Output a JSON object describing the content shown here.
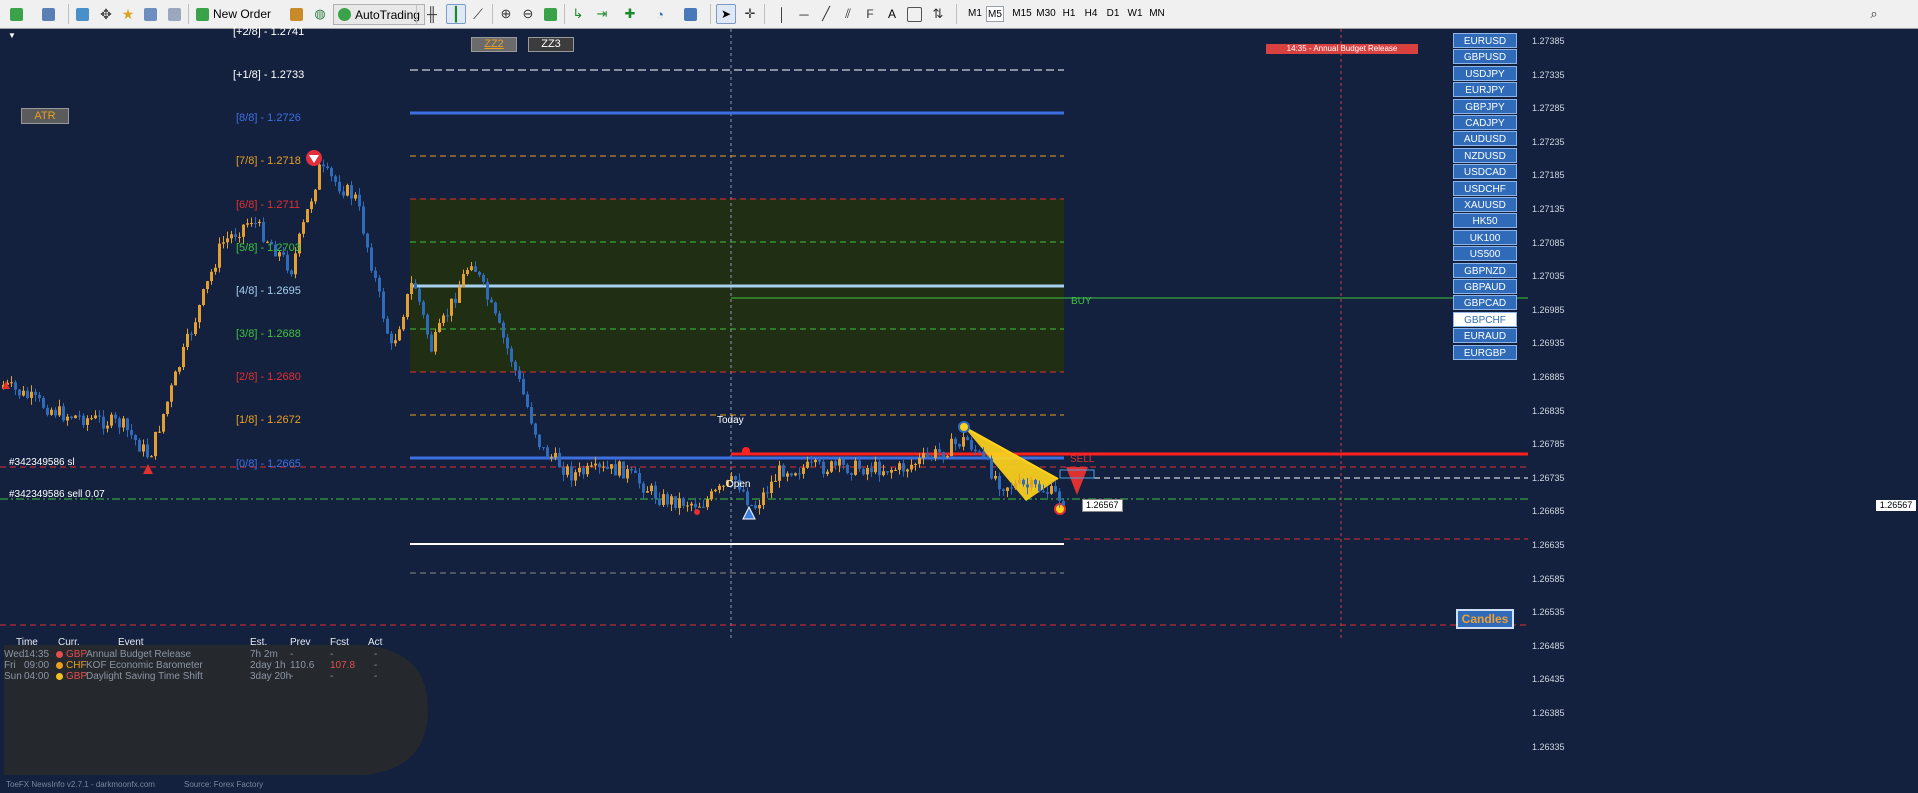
{
  "toolbar": {
    "new_order_label": "New Order",
    "autotrading_label": "AutoTrading",
    "text_tool_label": "A",
    "timeframes": [
      "M1",
      "M5",
      "M15",
      "M30",
      "H1",
      "H4",
      "D1",
      "W1",
      "MN"
    ],
    "active_timeframe": "M5"
  },
  "chart": {
    "background": "#13213f",
    "bull_color": "#e3a030",
    "bear_color": "#2f6bb8",
    "indicator_buttons": {
      "zz2": "ZZ2",
      "zz3": "ZZ3",
      "atr": "ATR"
    },
    "murrey_levels": [
      {
        "label": "[+2/8] - 1.2741",
        "color": "#ffffff"
      },
      {
        "label": "[+1/8] - 1.2733",
        "color": "#ffffff"
      },
      {
        "label": "[8/8] - 1.2726",
        "color": "#3d6fe0"
      },
      {
        "label": "[7/8] - 1.2718",
        "color": "#e8a020"
      },
      {
        "label": "[6/8] - 1.2711",
        "color": "#e03030"
      },
      {
        "label": "[5/8] - 1.2703",
        "color": "#3ec23e"
      },
      {
        "label": "[4/8] - 1.2695",
        "color": "#a6d0ee"
      },
      {
        "label": "[3/8] - 1.2688",
        "color": "#3ec23e"
      },
      {
        "label": "[2/8] - 1.2680",
        "color": "#e03030"
      },
      {
        "label": "[1/8] - 1.2672",
        "color": "#e8a020"
      },
      {
        "label": "[0/8] - 1.2665",
        "color": "#3d6fe0"
      }
    ],
    "today_label": "Today",
    "open_label": "Open",
    "buy_label": "BUY",
    "sell_label": "SELL",
    "order_sl_label": "#342349586 sl",
    "order_sell_label": "#342349586 sell 0.07",
    "current_price_tag": "1.26567",
    "axis_price_tag": "1.26567",
    "news_alert": "14:35 - Annual Budget Release",
    "candles_button": "Candles"
  },
  "price_axis": [
    "1.27385",
    "1.27335",
    "1.27285",
    "1.27235",
    "1.27185",
    "1.27135",
    "1.27085",
    "1.27035",
    "1.26985",
    "1.26935",
    "1.26885",
    "1.26835",
    "1.26785",
    "1.26735",
    "1.26685",
    "1.26635",
    "1.26585",
    "1.26535",
    "1.26485",
    "1.26435",
    "1.26385",
    "1.26335"
  ],
  "pair_buttons": [
    "EURUSD",
    "GBPUSD",
    "USDJPY",
    "EURJPY",
    "GBPJPY",
    "CADJPY",
    "AUDUSD",
    "NZDUSD",
    "USDCAD",
    "USDCHF",
    "XAUUSD",
    "HK50",
    "UK100",
    "US500",
    "GBPNZD",
    "GBPAUD",
    "GBPCAD",
    "GBPCHF",
    "EURAUD",
    "EURGBP"
  ],
  "selected_pair": "GBPCHF",
  "news_panel": {
    "headers": [
      "Time",
      "Curr.",
      "Event",
      "Est.",
      "Prev",
      "Fcst",
      "Act"
    ],
    "rows": [
      {
        "day": "Wed",
        "time": "14:35",
        "currency": "GBP",
        "dot": "#e05050",
        "event": "Annual Budget Release",
        "est": "7h 2m",
        "prev": "-",
        "fcst": "-",
        "act": "-"
      },
      {
        "day": "Fri",
        "time": "09:00",
        "currency": "CHF",
        "dot": "#e8a020",
        "event": "KOF Economic Barometer",
        "est": "2day 1h",
        "prev": "110.6",
        "fcst": "107.8",
        "act": "-"
      },
      {
        "day": "Sun",
        "time": "04:00",
        "currency": "GBP",
        "dot": "#f0c020",
        "event": "Daylight Saving Time Shift",
        "est": "3day 20h",
        "prev": "-",
        "fcst": "-",
        "act": "-"
      }
    ],
    "footer_left": "ToeFX NewsInfo v2.7.1 - darkmoonfx.com",
    "footer_right": "Source: Forex Factory"
  }
}
